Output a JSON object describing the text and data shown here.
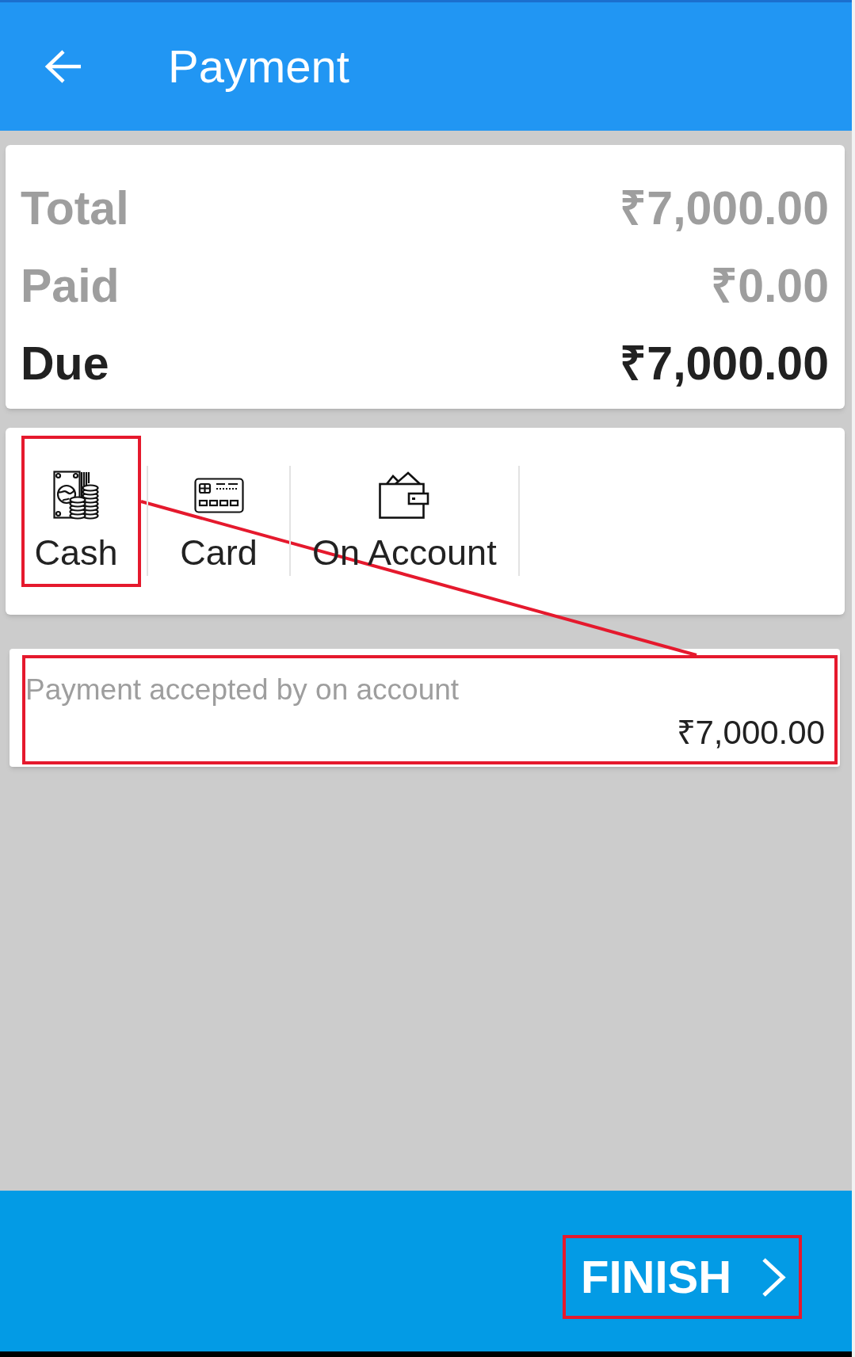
{
  "app_bar": {
    "title": "Payment"
  },
  "summary": [
    {
      "label": "Total",
      "amount": "₹7,000.00",
      "emphasized": false
    },
    {
      "label": "Paid",
      "amount": "₹0.00",
      "emphasized": false
    },
    {
      "label": "Due",
      "amount": "₹7,000.00",
      "emphasized": true
    }
  ],
  "payment_methods": [
    {
      "label": "Cash",
      "kind": "cash",
      "highlighted": true
    },
    {
      "label": "Card",
      "kind": "card",
      "highlighted": false
    },
    {
      "label": "On Account",
      "kind": "account",
      "highlighted": false
    }
  ],
  "payment_field": {
    "label": "Payment accepted by on account",
    "value": "₹7,000.00",
    "highlighted": true
  },
  "finish_button": {
    "label": "FINISH",
    "highlighted": true
  },
  "annotation_connector": true
}
